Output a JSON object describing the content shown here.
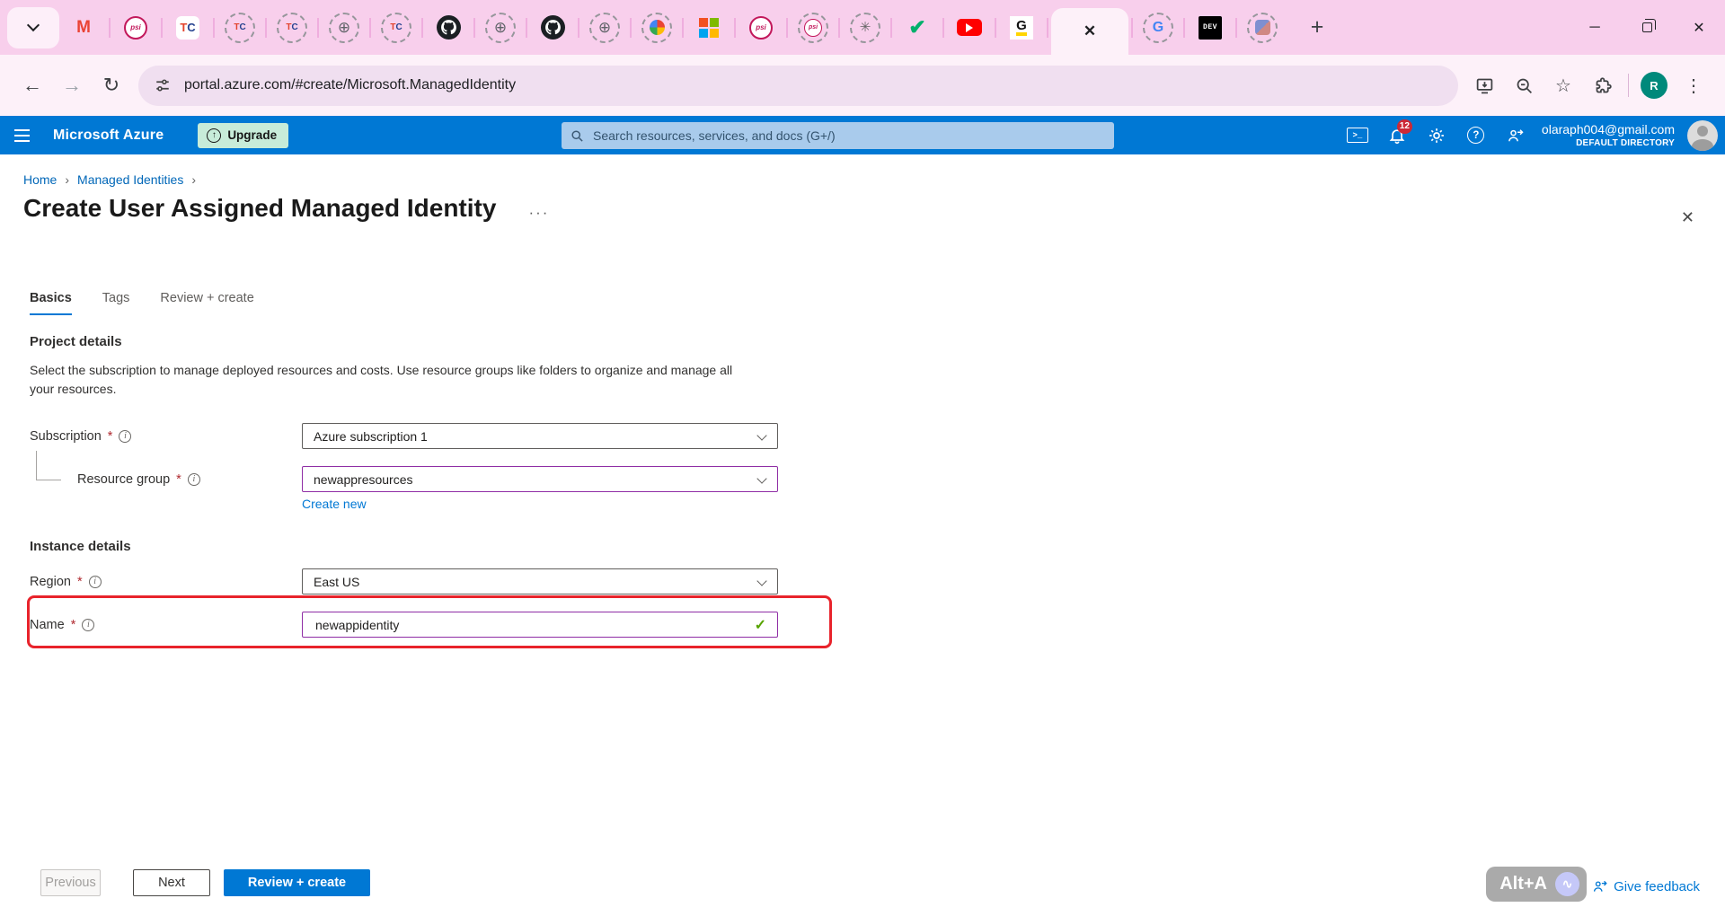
{
  "browser": {
    "tabs": [
      {
        "icon": "gmail"
      },
      {
        "icon": "psi"
      },
      {
        "icon": "tc"
      },
      {
        "icon": "tc-dashed"
      },
      {
        "icon": "tc-dashed"
      },
      {
        "icon": "globe-dashed"
      },
      {
        "icon": "tc-dashed"
      },
      {
        "icon": "github"
      },
      {
        "icon": "globe-dashed"
      },
      {
        "icon": "github"
      },
      {
        "icon": "globe-dashed"
      },
      {
        "icon": "colorwheel-dashed"
      },
      {
        "icon": "microsoft"
      },
      {
        "icon": "psi"
      },
      {
        "icon": "psi-dashed"
      },
      {
        "icon": "openai-dashed"
      },
      {
        "icon": "check"
      },
      {
        "icon": "youtube"
      },
      {
        "icon": "g-highlight"
      },
      {
        "icon": "close",
        "active": true
      },
      {
        "icon": "google-dashed"
      },
      {
        "icon": "dev"
      },
      {
        "icon": "logo-dashed"
      }
    ],
    "new_tab_button": "+",
    "url": "portal.azure.com/#create/Microsoft.ManagedIdentity",
    "profile_initial": "R"
  },
  "azure_bar": {
    "brand": "Microsoft Azure",
    "upgrade_label": "Upgrade",
    "search_placeholder": "Search resources, services, and docs (G+/)",
    "notification_count": "12",
    "account": {
      "email": "olaraph004@gmail.com",
      "directory": "DEFAULT DIRECTORY"
    }
  },
  "page": {
    "breadcrumb": {
      "home": "Home",
      "managed_identities": "Managed Identities"
    },
    "title": "Create User Assigned Managed Identity",
    "more_options": "···",
    "required_marker": "*",
    "tabs": {
      "basics": "Basics",
      "tags": "Tags",
      "review_create": "Review + create"
    },
    "project_details": {
      "heading": "Project details",
      "description": "Select the subscription to manage deployed resources and costs. Use resource groups like folders to organize and manage all your resources.",
      "subscription_label": "Subscription",
      "subscription_value": "Azure subscription 1",
      "resource_group_label": "Resource group",
      "resource_group_value": "newappresources",
      "create_new_label": "Create new"
    },
    "instance_details": {
      "heading": "Instance details",
      "region_label": "Region",
      "region_value": "East US",
      "name_label": "Name",
      "name_value": "newappidentity"
    },
    "footer": {
      "previous": "Previous",
      "next": "Next",
      "review_create": "Review + create"
    },
    "feedback": {
      "shortcut": "Alt+A",
      "link_label": "Give feedback"
    }
  },
  "colors": {
    "azure_blue": "#0078d4",
    "chrome_theme_pink": "#f8cfec",
    "highlight_red": "#e8232b",
    "focus_purple": "#8f2da5",
    "valid_green": "#57a300",
    "upgrade_mint": "#c7ecd9"
  }
}
